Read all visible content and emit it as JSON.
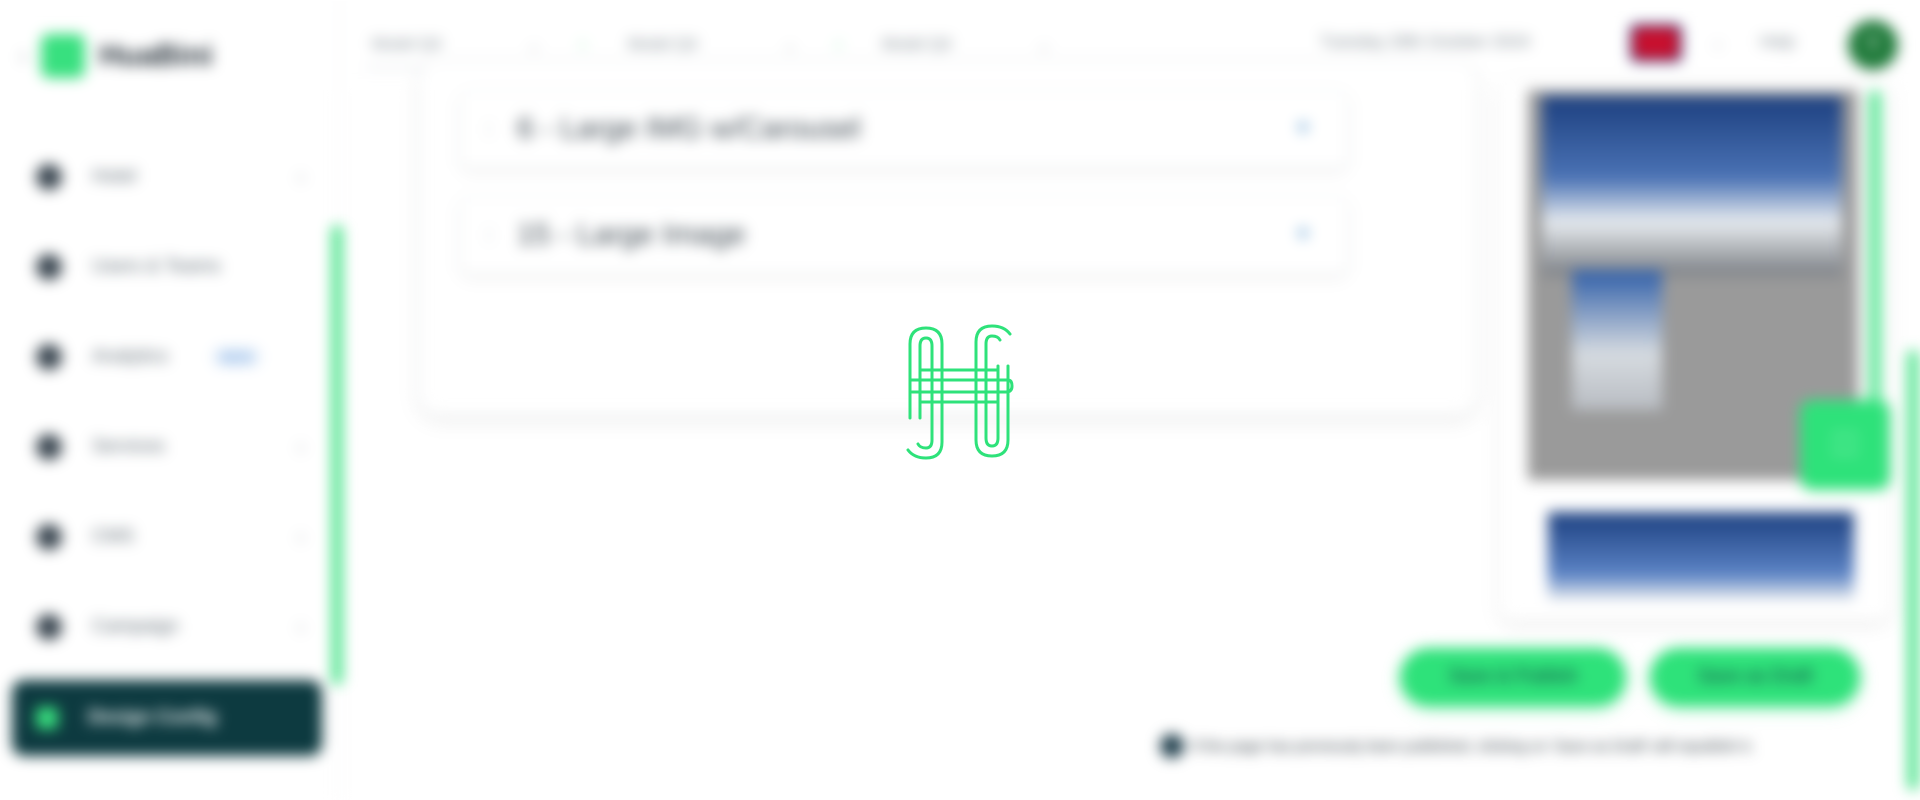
{
  "sidebar": {
    "logo_text": "HuaBini",
    "items": [
      {
        "label": "Hotel",
        "icon": "pin-icon"
      },
      {
        "label": "Users & Teams",
        "icon": "user-icon"
      },
      {
        "label": "Analytics",
        "icon": "analytics-icon",
        "badge": "NEW"
      },
      {
        "label": "Services",
        "icon": "services-icon"
      },
      {
        "label": "CMS",
        "icon": "folder-icon"
      },
      {
        "label": "Campaign",
        "icon": "megaphone-icon"
      },
      {
        "label": "Design Config",
        "icon": "design-icon"
      }
    ]
  },
  "topbar": {
    "model_select_1": "Model Q4",
    "model_select_2": "Model Q4",
    "model_select_3": "Model Q4",
    "date": "Tuesday 29th October 2024",
    "help": "Help",
    "avatar_initial": "T"
  },
  "main": {
    "sections": [
      {
        "title": "6 - Large IMG w/Carousel"
      },
      {
        "title": "15 - Large Image"
      }
    ]
  },
  "actions": {
    "save_publish": "Save & Publish",
    "save_draft": "Save as Draft",
    "notice": "If the page has previously been published, clicking on 'Save as Draft' will republish it."
  },
  "colors": {
    "accent": "#2ee27a",
    "sidebar_active_bg": "#0d3a40"
  }
}
